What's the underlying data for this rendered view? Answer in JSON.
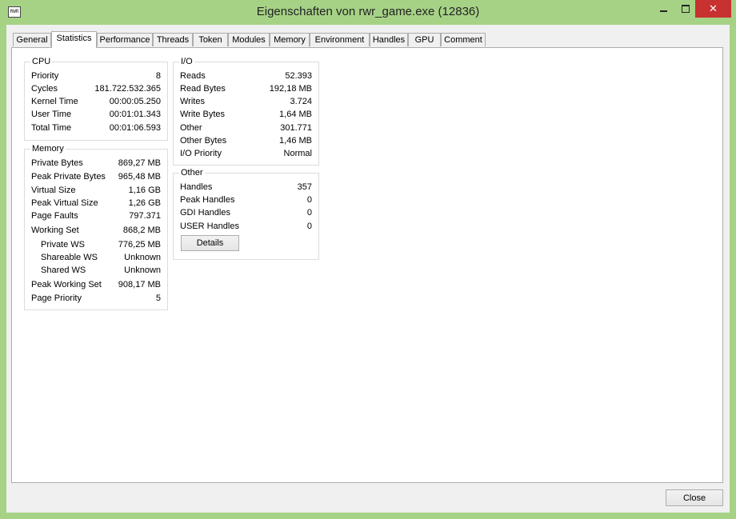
{
  "window": {
    "title": "Eigenschaften von rwr_game.exe (12836)",
    "app_icon_text": "RWR",
    "minimize_glyph": "",
    "close_glyph": "✕"
  },
  "tabs": [
    {
      "label": "General",
      "active": false
    },
    {
      "label": "Statistics",
      "active": true
    },
    {
      "label": "Performance",
      "active": false
    },
    {
      "label": "Threads",
      "active": false
    },
    {
      "label": "Token",
      "active": false
    },
    {
      "label": "Modules",
      "active": false
    },
    {
      "label": "Memory",
      "active": false
    },
    {
      "label": "Environment",
      "active": false
    },
    {
      "label": "Handles",
      "active": false
    },
    {
      "label": "GPU",
      "active": false
    },
    {
      "label": "Comment",
      "active": false
    }
  ],
  "cpu": {
    "title": "CPU",
    "rows": [
      {
        "label": "Priority",
        "value": "8"
      },
      {
        "label": "Cycles",
        "value": "181.722.532.365"
      },
      {
        "label": "Kernel Time",
        "value": "00:00:05.250"
      },
      {
        "label": "User Time",
        "value": "00:01:01.343"
      },
      {
        "label": "Total Time",
        "value": "00:01:06.593"
      }
    ]
  },
  "memory": {
    "title": "Memory",
    "rows": [
      {
        "label": "Private Bytes",
        "value": "869,27 MB"
      },
      {
        "label": "Peak Private Bytes",
        "value": "965,48 MB"
      },
      {
        "label": "Virtual Size",
        "value": "1,16 GB"
      },
      {
        "label": "Peak Virtual Size",
        "value": "1,26 GB"
      },
      {
        "label": "Page Faults",
        "value": "797.371"
      },
      {
        "label": "Working Set",
        "value": "868,2 MB"
      },
      {
        "label": "Private WS",
        "value": "776,25 MB"
      },
      {
        "label": "Shareable WS",
        "value": "Unknown"
      },
      {
        "label": "Shared WS",
        "value": "Unknown"
      },
      {
        "label": "Peak Working Set",
        "value": "908,17 MB"
      },
      {
        "label": "Page Priority",
        "value": "5"
      }
    ]
  },
  "io": {
    "title": "I/O",
    "rows": [
      {
        "label": "Reads",
        "value": "52.393"
      },
      {
        "label": "Read Bytes",
        "value": "192,18 MB"
      },
      {
        "label": "Writes",
        "value": "3.724"
      },
      {
        "label": "Write Bytes",
        "value": "1,64 MB"
      },
      {
        "label": "Other",
        "value": "301.771"
      },
      {
        "label": "Other Bytes",
        "value": "1,46 MB"
      },
      {
        "label": "I/O Priority",
        "value": "Normal"
      }
    ]
  },
  "other": {
    "title": "Other",
    "rows": [
      {
        "label": "Handles",
        "value": "357"
      },
      {
        "label": "Peak Handles",
        "value": "0"
      },
      {
        "label": "GDI Handles",
        "value": "0"
      },
      {
        "label": "USER Handles",
        "value": "0"
      }
    ],
    "details_label": "Details"
  },
  "footer": {
    "close_label": "Close"
  }
}
